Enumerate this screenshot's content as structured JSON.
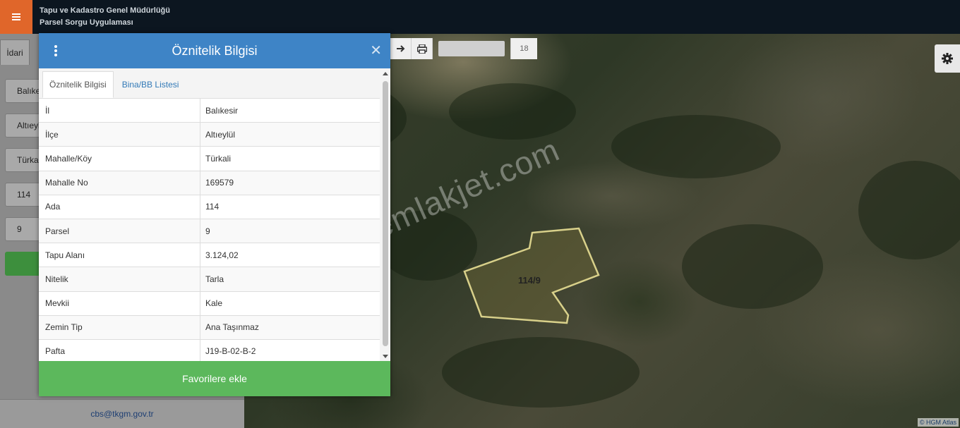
{
  "app": {
    "title_line1": "Tapu ve Kadastro Genel Müdürlüğü",
    "title_line2": "Parsel Sorgu Uygulaması",
    "accent_color": "#e0662a"
  },
  "left_panel": {
    "tab_label": "İdari",
    "fields": [
      "Balıke",
      "Altıeyl",
      "Türka",
      "114",
      "9"
    ],
    "footer_email": "cbs@tkgm.gov.tr"
  },
  "map": {
    "zoom_level": "18",
    "watermark": "emlakjet.com",
    "parcel_label": "114/9",
    "attribution": "© HGM Atlas",
    "icons": [
      "arrow-right-icon",
      "print-icon",
      "gear-icon"
    ]
  },
  "modal": {
    "title": "Öznitelik Bilgisi",
    "header_color": "#3e84c6",
    "tabs": [
      {
        "label": "Öznitelik Bilgisi",
        "active": true
      },
      {
        "label": "Bina/BB Listesi",
        "active": false
      }
    ],
    "rows": [
      {
        "key": "İl",
        "value": "Balıkesir"
      },
      {
        "key": "İlçe",
        "value": "Altıeylül"
      },
      {
        "key": "Mahalle/Köy",
        "value": "Türkali"
      },
      {
        "key": "Mahalle No",
        "value": "169579"
      },
      {
        "key": "Ada",
        "value": "114"
      },
      {
        "key": "Parsel",
        "value": "9"
      },
      {
        "key": "Tapu Alanı",
        "value": "3.124,02"
      },
      {
        "key": "Nitelik",
        "value": "Tarla"
      },
      {
        "key": "Mevkii",
        "value": "Kale"
      },
      {
        "key": "Zemin Tip",
        "value": "Ana Taşınmaz"
      },
      {
        "key": "Pafta",
        "value": "J19-B-02-B-2"
      }
    ],
    "favorite_button": "Favorilere ekle",
    "button_color": "#5cb85c"
  }
}
